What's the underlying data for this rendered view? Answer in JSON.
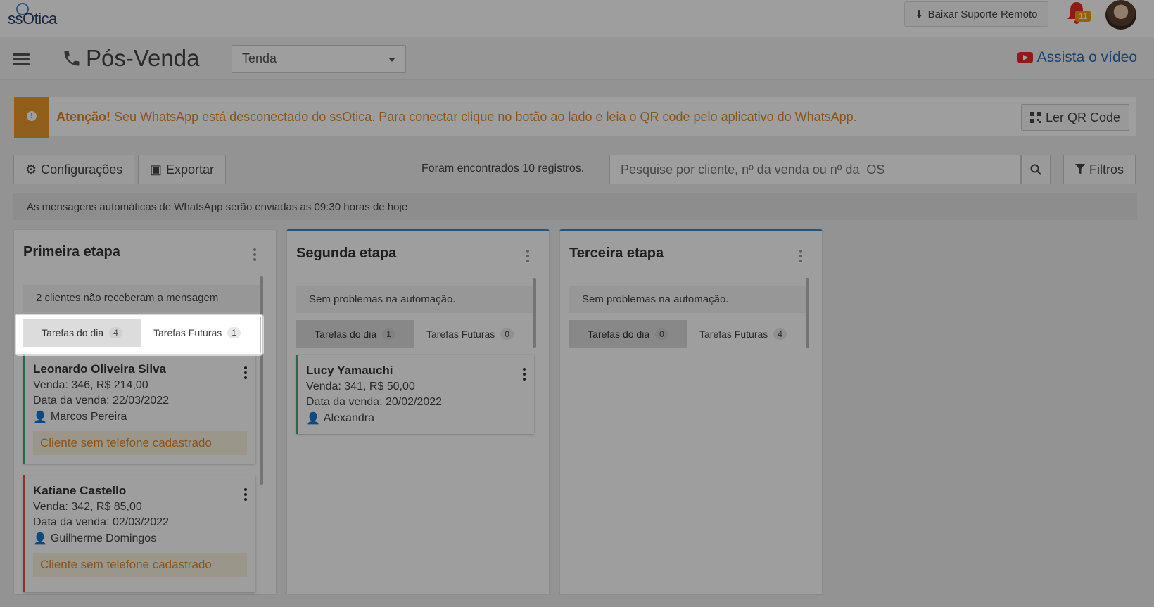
{
  "app": {
    "logo": "ssOtica"
  },
  "topbar": {
    "remote_support_label": "Baixar Suporte Remoto",
    "notifications_count": "11"
  },
  "header": {
    "title": "Pós-Venda",
    "store_selected": "Tenda",
    "video_link": "Assista o vídeo"
  },
  "alert": {
    "strong": "Atenção!",
    "message": "Seu WhatsApp está desconectado do ssOtica. Para conectar clique no botão ao lado e leia o QR code pelo aplicativo do WhatsApp.",
    "qr_button": "Ler QR Code"
  },
  "toolbar": {
    "settings_label": "Configurações",
    "export_label": "Exportar",
    "found_text": "Foram encontrados 10 registros.",
    "search_placeholder": "Pesquise por cliente, nº da venda ou nº da  OS",
    "filters_label": "Filtros"
  },
  "info_bar": "As mensagens automáticas de WhatsApp serão enviadas as 09:30 horas de hoje",
  "columns": [
    {
      "title": "Primeira etapa",
      "status": "2 clientes não receberam a mensagem",
      "tab_today": "Tarefas do dia",
      "tab_today_count": "4",
      "tab_future": "Tarefas Futuras",
      "tab_future_count": "1",
      "cards": [
        {
          "name": "Leonardo Oliveira Silva",
          "sale": "Venda: 346, R$ 214,00",
          "date": "Data da venda: 22/03/2022",
          "seller": "Marcos Pereira",
          "warning": "Cliente sem telefone cadastrado"
        },
        {
          "name": "Katiane Castello",
          "sale": "Venda: 342, R$ 85,00",
          "date": "Data da venda: 02/03/2022",
          "seller": "Guilherme Domingos",
          "warning": "Cliente sem telefone cadastrado"
        }
      ]
    },
    {
      "title": "Segunda etapa",
      "status": "Sem problemas na automação.",
      "tab_today": "Tarefas do dia",
      "tab_today_count": "1",
      "tab_future": "Tarefas Futuras",
      "tab_future_count": "0",
      "cards": [
        {
          "name": "Lucy Yamauchi",
          "sale": "Venda: 341, R$ 50,00",
          "date": "Data da venda: 20/02/2022",
          "seller": "Alexandra"
        }
      ]
    },
    {
      "title": "Terceira etapa",
      "status": "Sem problemas na automação.",
      "tab_today": "Tarefas do dia",
      "tab_today_count": "0",
      "tab_future": "Tarefas Futuras",
      "tab_future_count": "4",
      "cards": []
    }
  ],
  "colors": {
    "accent_blue": "#3b88c8",
    "warning_orange": "#e08a2a",
    "success_green": "#3cab80",
    "danger_red": "#d9534f"
  }
}
